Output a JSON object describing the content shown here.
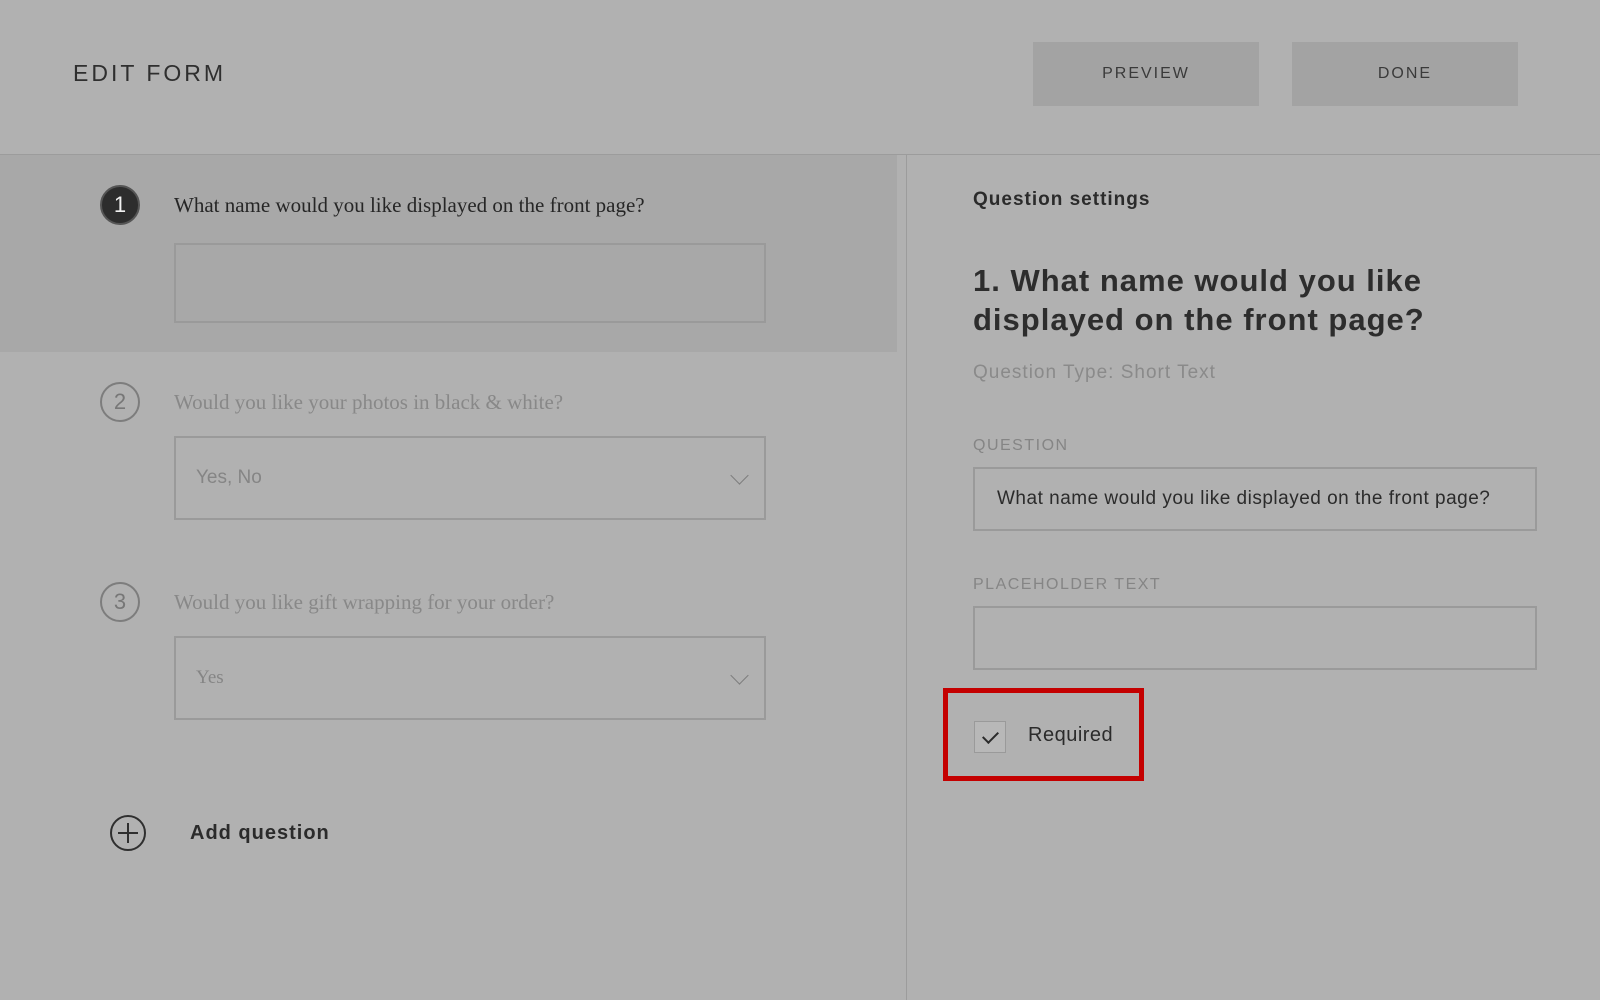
{
  "header": {
    "title": "EDIT FORM",
    "preview_label": "PREVIEW",
    "done_label": "DONE"
  },
  "questions": [
    {
      "number": "1",
      "text": "What name would you like displayed on the front page?",
      "value": ""
    },
    {
      "number": "2",
      "text": "Would you like your photos in black & white?",
      "value": "Yes, No"
    },
    {
      "number": "3",
      "text": "Would you like gift wrapping for your order?",
      "value": "Yes"
    }
  ],
  "add_question_label": "Add question",
  "settings": {
    "title": "Question settings",
    "heading": "1. What name would you like displayed on the front page?",
    "type": "Question Type: Short Text",
    "question_label": "QUESTION",
    "question_value": "What name would you like displayed on the front page?",
    "placeholder_label": "PLACEHOLDER TEXT",
    "placeholder_value": "",
    "required_label": "Required",
    "required_checked": true
  },
  "colors": {
    "background": "#b1b1b1",
    "active_question": "#a8a8a8",
    "highlight": "#c40000"
  }
}
